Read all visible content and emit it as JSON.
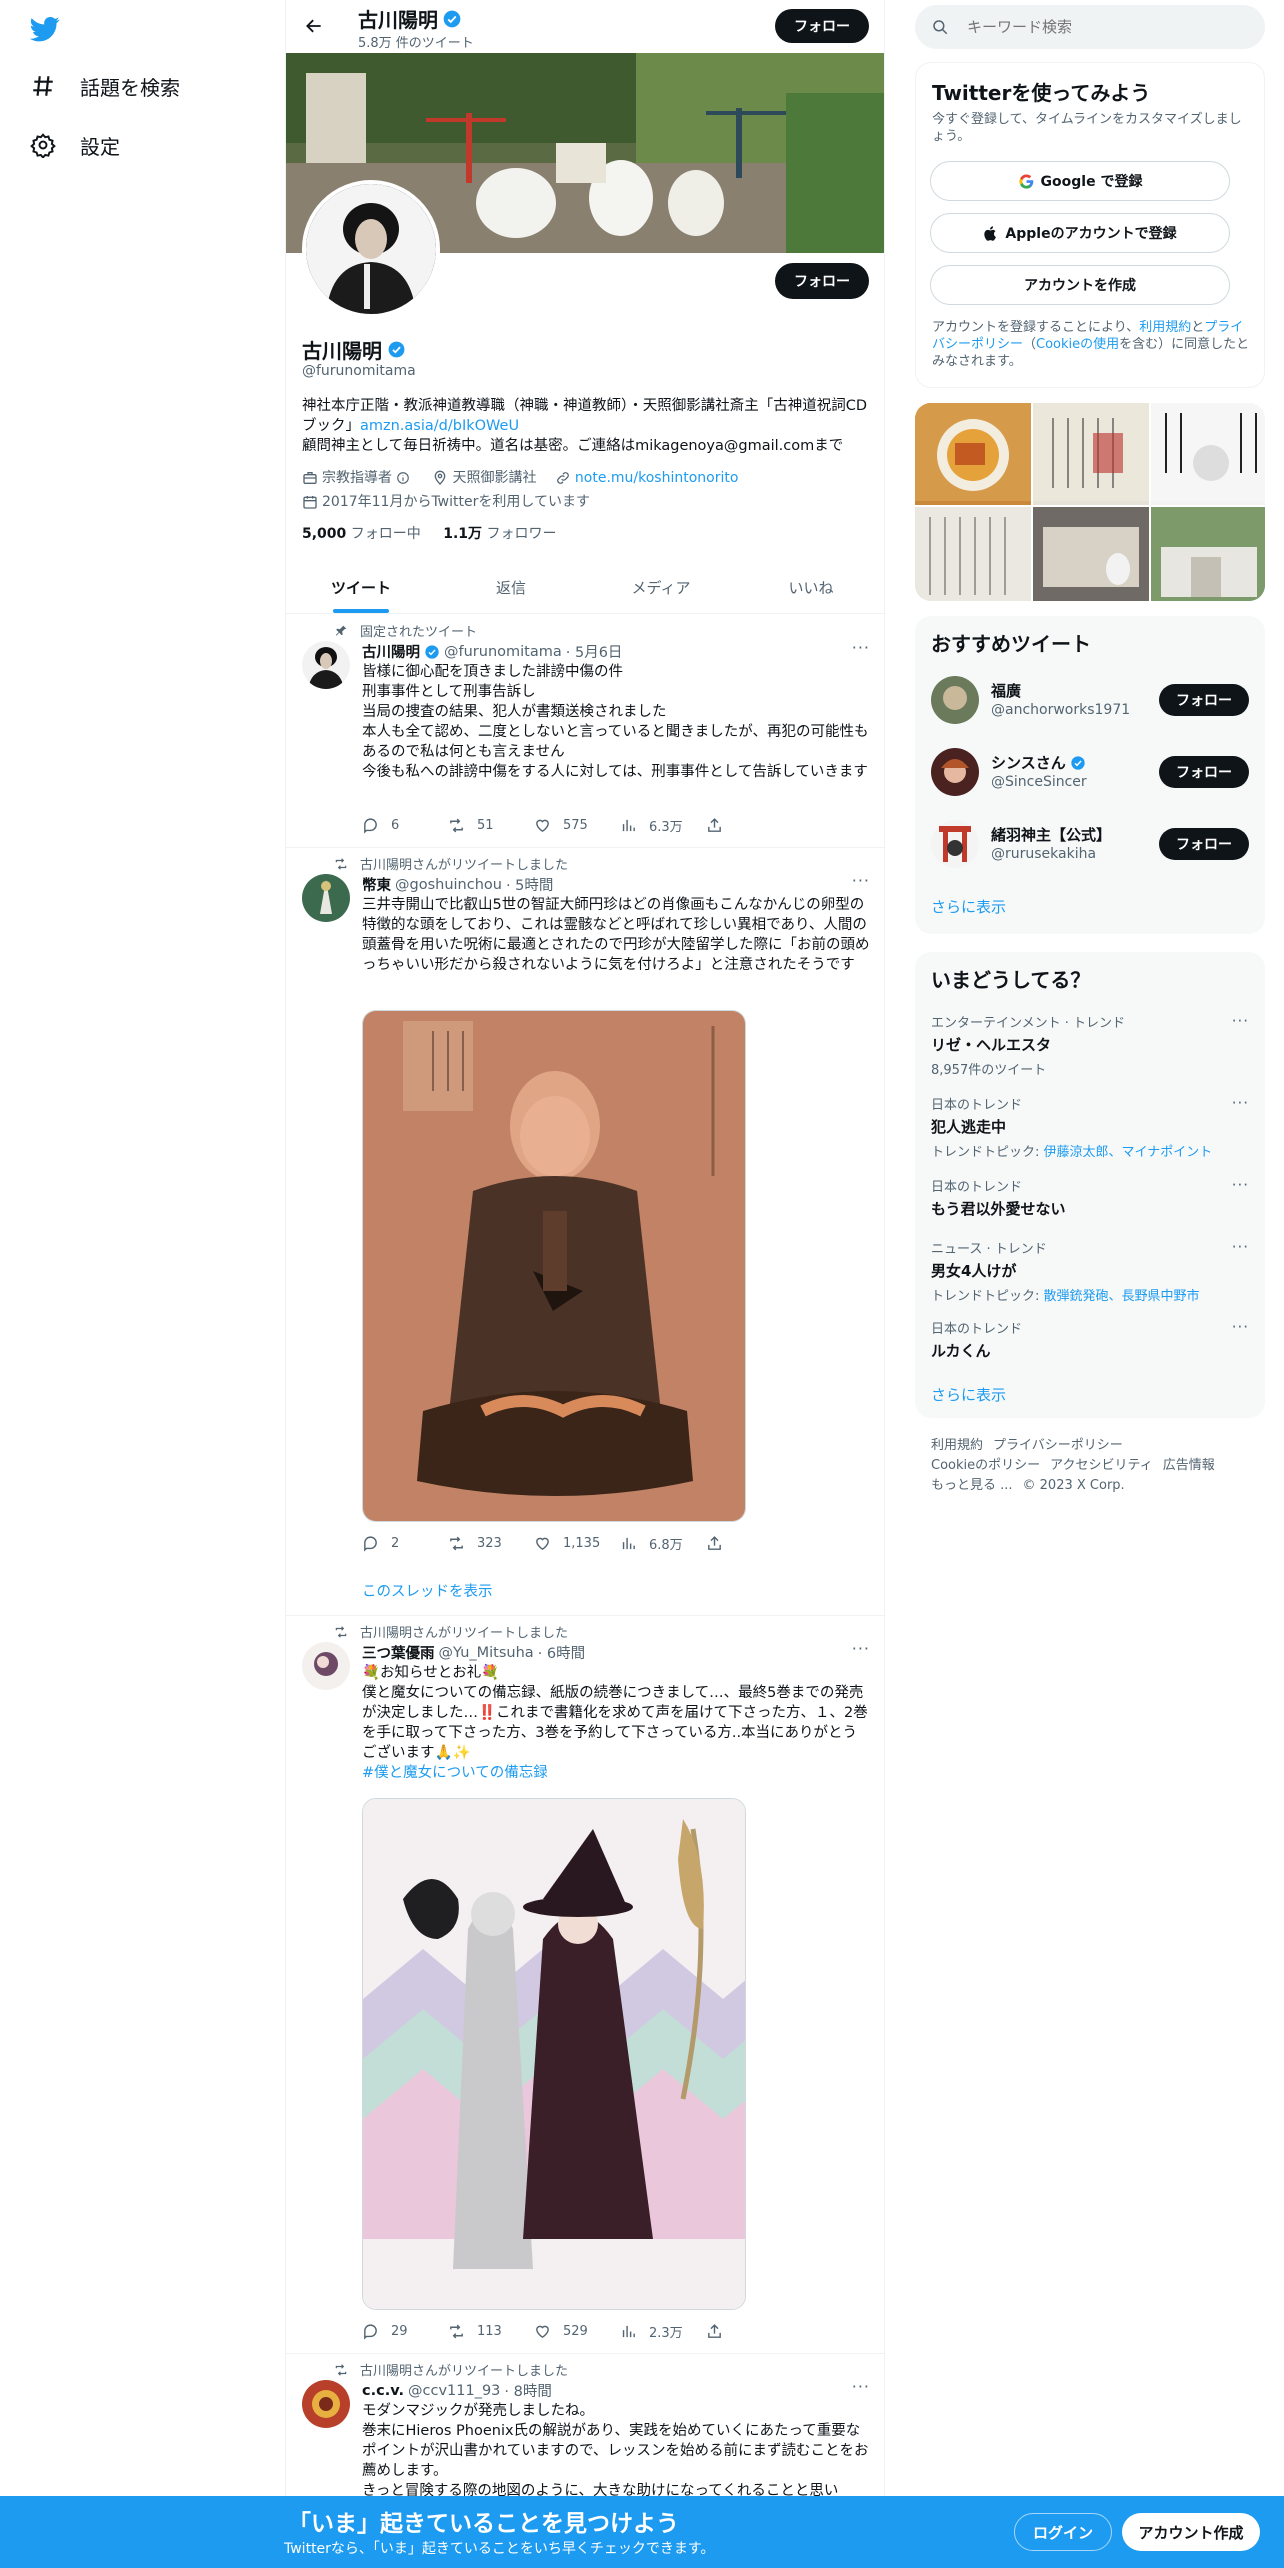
{
  "nav": {
    "items": [
      {
        "label": "話題を検索",
        "icon": "hashtag-icon"
      },
      {
        "label": "設定",
        "icon": "gear-icon"
      }
    ]
  },
  "header": {
    "name": "古川陽明",
    "tweet_count": "5.8万 件のツイート",
    "follow_label": "フォロー"
  },
  "profile": {
    "name": "古川陽明",
    "handle": "@furunomitama",
    "follow_label": "フォロー",
    "bio_1": "神社本庁正階・教派神道教導職（神職・神道教師）・天照御影講社斎主「古神道祝詞CDブック」",
    "bio_link": "amzn.asia/d/bIkOWeU",
    "bio_2": "顧問神主として毎日祈祷中。道名は基密。ご連絡はmikagenoya@gmail.comまで",
    "category": "宗教指導者",
    "location": "天照御影講社",
    "website": "note.mu/koshintonorito",
    "joined": "2017年11月からTwitterを利用しています",
    "following_count": "5,000",
    "following_label": "フォロー中",
    "followers_count": "1.1万",
    "followers_label": "フォロワー"
  },
  "tabs": [
    {
      "label": "ツイート"
    },
    {
      "label": "返信"
    },
    {
      "label": "メディア"
    },
    {
      "label": "いいね"
    }
  ],
  "tweets": [
    {
      "context": "固定されたツイート",
      "name": "古川陽明",
      "handle": "@furunomitama",
      "time": "· 5月6日",
      "text": "皆様に御心配を頂きました誹謗中傷の件\n刑事事件として刑事告訴し\n当局の捜査の結果、犯人が書類送検されました\n本人も全て認め、二度としないと言っていると聞きましたが、再犯の可能性もあるので私は何とも言えません\n今後も私への誹謗中傷をする人に対しては、刑事事件として告訴していきます",
      "replies": "6",
      "retweets": "51",
      "likes": "575",
      "views": "6.3万"
    },
    {
      "context": "古川陽明さんがリツイートしました",
      "name": "幣東",
      "handle": "@goshuinchou",
      "time": "· 5時間",
      "text": "三井寺開山で比叡山5世の智証大師円珍はどの肖像画もこんなかんじの卵型の特徴的な頭をしており、これは霊骸などと呼ばれて珍しい異相であり、人間の頭蓋骨を用いた呪術に最適とされたので円珍が大陸留学した際に「お前の頭めっちゃいい形だから殺されないように気を付けろよ」と注意されたそうです",
      "replies": "2",
      "retweets": "323",
      "likes": "1,135",
      "views": "6.8万",
      "thread_label": "このスレッドを表示"
    },
    {
      "context": "古川陽明さんがリツイートしました",
      "name": "三つ葉優雨",
      "handle": "@Yu_Mitsuha",
      "time": "· 6時間",
      "text": "💐お知らせとお礼💐\n僕と魔女についての備忘録、紙版の続巻につきまして…、最終5巻までの発売が決定しました…‼️これまで書籍化を求めて声を届けて下さった方、１、2巻を手に取って下さった方、3巻を予約して下さっている方..本当にありがとうございます🙏✨",
      "hashtag": "#僕と魔女についての備忘録",
      "replies": "29",
      "retweets": "113",
      "likes": "529",
      "views": "2.3万"
    },
    {
      "context": "古川陽明さんがリツイートしました",
      "name": "c.c.v.",
      "handle": "@ccv111_93",
      "time": "· 8時間",
      "text": "モダンマジックが発売しましたね。\n巻末にHieros Phoenix氏の解説があり、実践を始めていくにあたって重要なポイントが沢山書かれていますので、レッスンを始める前にまず読むことをお薦めします。\nきっと冒険する際の地図のように、大きな助けになってくれることと思い"
    }
  ],
  "search": {
    "placeholder": "キーワード検索"
  },
  "signup": {
    "title": "Twitterを使ってみよう",
    "subtitle": "今すぐ登録して、タイムラインをカスタマイズしましょう。",
    "google": "Google で登録",
    "apple": "Appleのアカウントで登録",
    "create": "アカウントを作成",
    "terms_1": "アカウントを登録することにより、",
    "terms_link1": "利用規約",
    "terms_2": "と",
    "terms_link2": "プライバシーポリシー",
    "terms_3": "（",
    "terms_link3": "Cookieの使用",
    "terms_4": "を含む）に同意したとみなされます。"
  },
  "recommended": {
    "title": "おすすめツイート",
    "users": [
      {
        "name": "福廣",
        "handle": "@anchorworks1971",
        "verified": false
      },
      {
        "name": "シンスさん",
        "handle": "@SinceSincer",
        "verified": true
      },
      {
        "name": "緒羽神主【公式】",
        "handle": "@rurusekakiha",
        "verified": false
      }
    ],
    "follow_label": "フォロー",
    "show_more": "さらに表示"
  },
  "trends": {
    "title": "いまどうしてる？",
    "items": [
      {
        "cat": "エンターテインメント · トレンド",
        "title": "リゼ・ヘルエスタ",
        "sub": "8,957件のツイート"
      },
      {
        "cat": "日本のトレンド",
        "title": "犯人逃走中",
        "sub_label": "トレンドトピック: ",
        "sub_links": "伊藤涼太郎、マイナポイント"
      },
      {
        "cat": "日本のトレンド",
        "title": "もう君以外愛せない"
      },
      {
        "cat": "ニュース · トレンド",
        "title": "男女4人けが",
        "sub_label": "トレンドトピック: ",
        "sub_links": "散弾銃発砲、長野県中野市"
      },
      {
        "cat": "日本のトレンド",
        "title": "ルカくん"
      }
    ],
    "show_more": "さらに表示"
  },
  "footer": {
    "l1": "利用規約",
    "l2": "プライバシーポリシー",
    "l3": "Cookieのポリシー",
    "l4": "アクセシビリティ",
    "l5": "広告情報",
    "l6": "もっと見る ...",
    "copy": "© 2023 X Corp."
  },
  "bottombar": {
    "title": "「いま」起きていることを見つけよう",
    "subtitle": "Twitterなら、「いま」起きていることをいち早くチェックできます。",
    "login": "ログイン",
    "signup": "アカウント作成"
  },
  "colors": {
    "accent": "#1d9bf0",
    "dark": "#0f1419",
    "muted": "#536471"
  }
}
